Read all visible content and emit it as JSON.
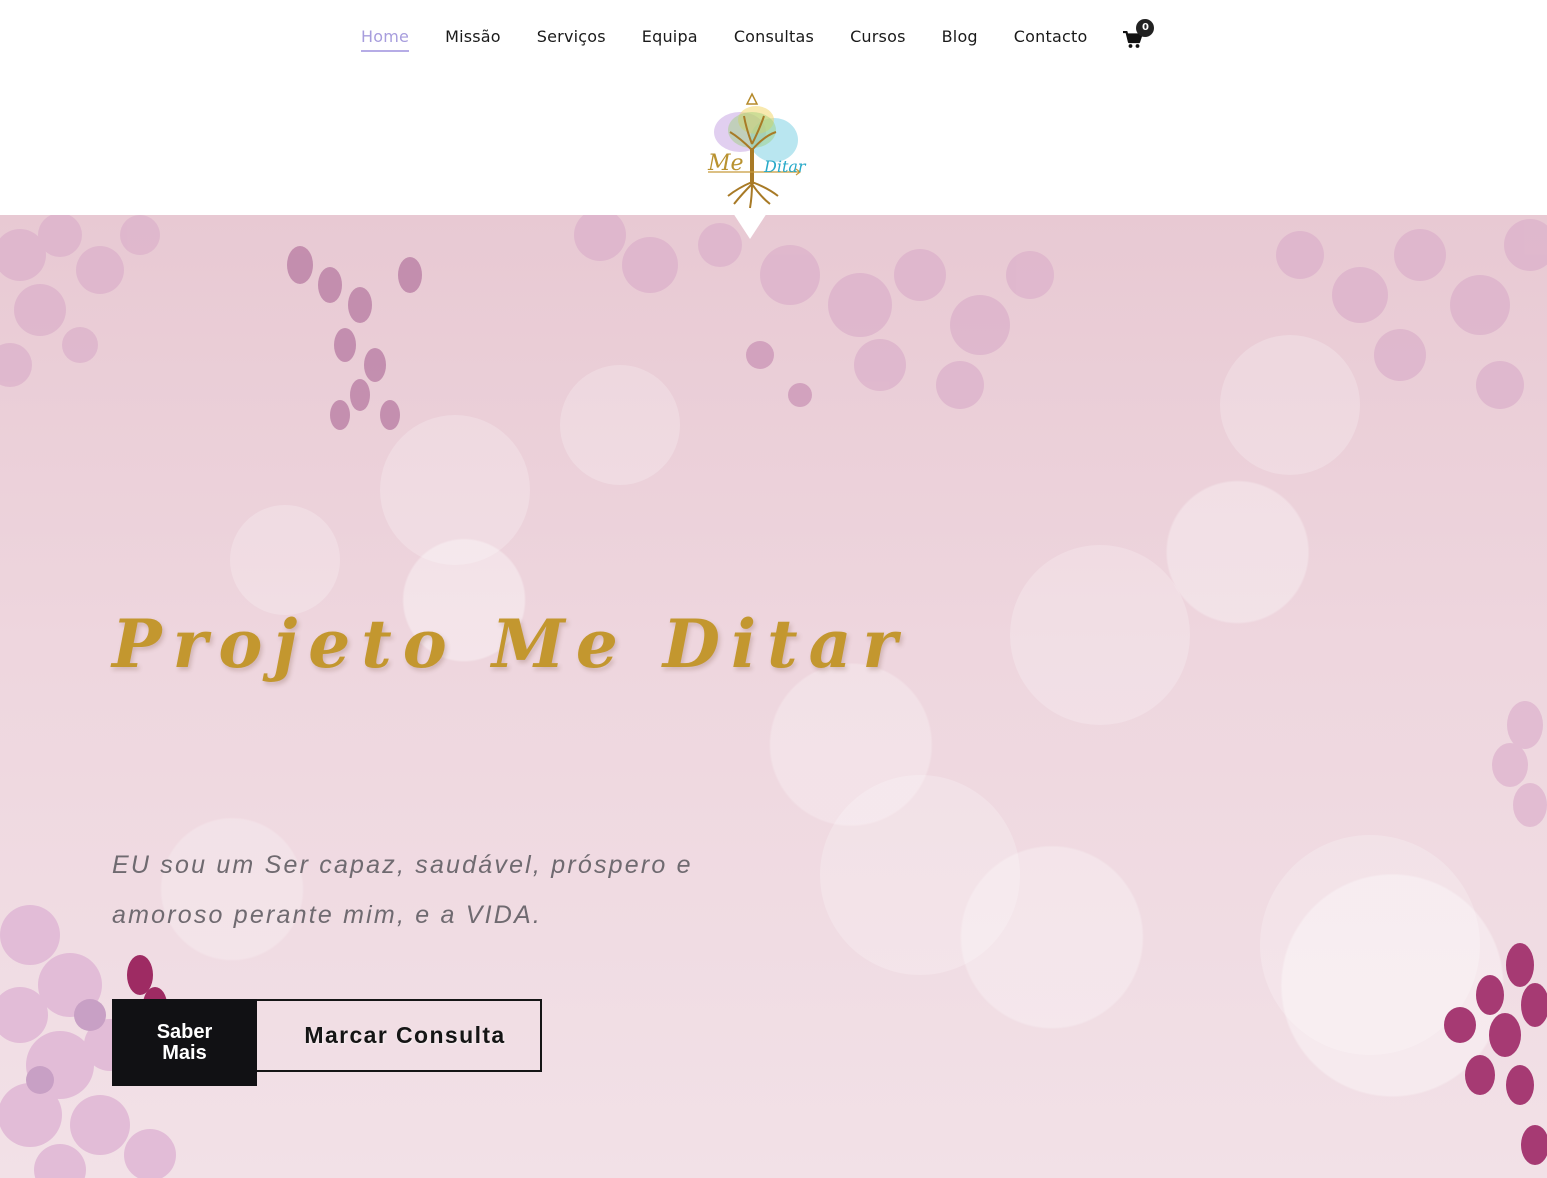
{
  "nav": {
    "items": [
      {
        "label": "Home",
        "active": true
      },
      {
        "label": "Missão"
      },
      {
        "label": "Serviços"
      },
      {
        "label": "Equipa"
      },
      {
        "label": "Consultas"
      },
      {
        "label": "Cursos"
      },
      {
        "label": "Blog"
      },
      {
        "label": "Contacto"
      }
    ],
    "cart_icon": "shopping-cart-icon",
    "cart_count": "0"
  },
  "logo": {
    "text_me": "Me",
    "text_ditar": "Ditar",
    "icon": "tree-of-life-logo"
  },
  "hero": {
    "title": "Projeto Me Ditar",
    "text_line1": "EU sou  um Ser capaz, saudável, próspero e",
    "text_line2": "amoroso perante mim, e a VIDA.",
    "primary_button": "Saber Mais",
    "secondary_button": "Marcar Consulta"
  },
  "colors": {
    "accent_nav": "#a79ddd",
    "title_gold": "#c3972f",
    "hero_bg": "#ecd2db",
    "button_dark": "#111114"
  }
}
